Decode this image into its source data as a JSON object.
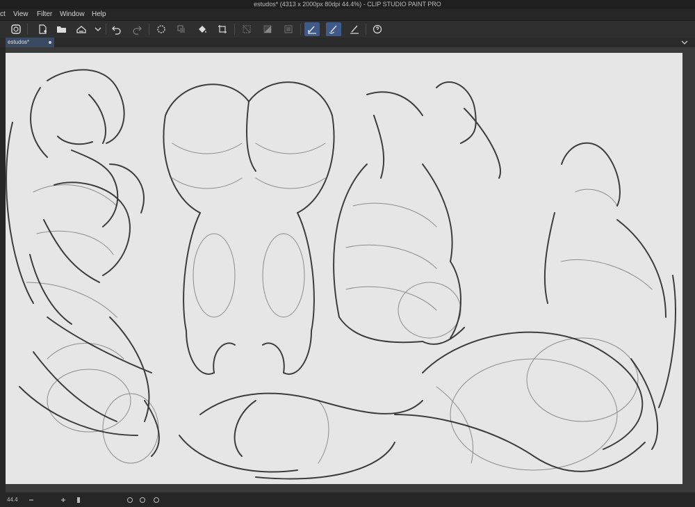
{
  "window": {
    "title": "estudos* (4313 x 2000px 80dpi 44.4%)  - CLIP STUDIO PAINT PRO"
  },
  "menu": {
    "items": [
      "ct",
      "View",
      "Filter",
      "Window",
      "Help"
    ]
  },
  "toolbar": {
    "buttons": [
      "app-icon",
      "new-icon",
      "open-icon",
      "save-icon",
      "dropdown-icon",
      "undo-icon",
      "redo-icon",
      "clear-icon",
      "paste-icon",
      "fill-icon",
      "transform-icon",
      "deselect-icon",
      "invert-icon",
      "show-selection-icon",
      "pen-icon",
      "brush-icon",
      "eraser-icon",
      "help-icon"
    ],
    "active_button": "pen-icon"
  },
  "document_tab": {
    "label": "estudos*"
  },
  "status": {
    "zoom": "44.4"
  },
  "colors": {
    "accent": "#3f5a86",
    "canvas": "#e6e6e6",
    "ink": "#1a1a1a"
  }
}
